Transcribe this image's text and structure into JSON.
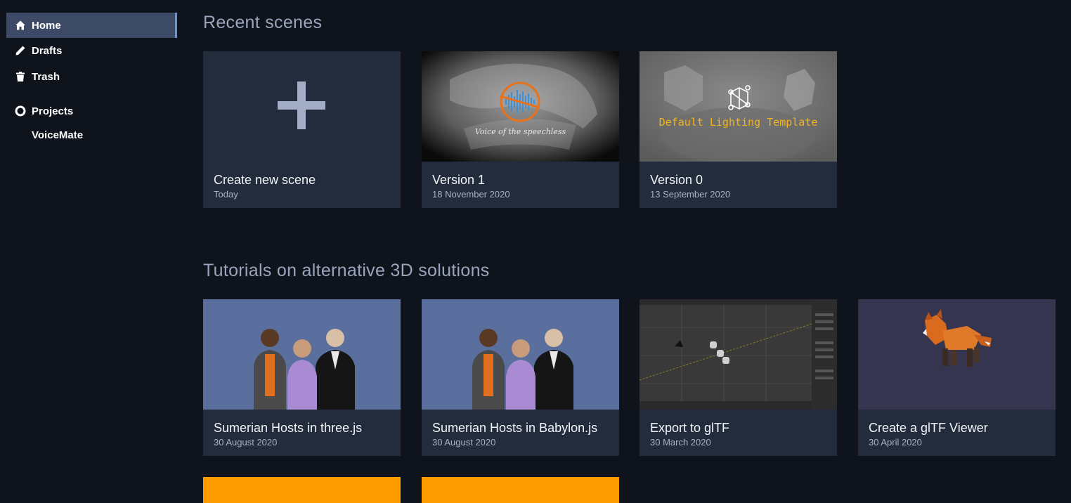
{
  "sidebar": {
    "items": [
      {
        "label": "Home",
        "icon": "home-icon",
        "active": true
      },
      {
        "label": "Drafts",
        "icon": "pencil-icon",
        "active": false
      },
      {
        "label": "Trash",
        "icon": "trash-icon",
        "active": false
      },
      {
        "label": "Projects",
        "icon": "projects-icon",
        "active": false
      }
    ],
    "projects": [
      "VoiceMate"
    ]
  },
  "recent": {
    "title": "Recent scenes",
    "cards": [
      {
        "title": "Create new scene",
        "date": "Today"
      },
      {
        "title": "Version 1",
        "date": "18 November 2020",
        "thumb_caption": "Voice of the speechless"
      },
      {
        "title": "Version 0",
        "date": "13 September 2020",
        "thumb_caption": "Default Lighting Template"
      }
    ]
  },
  "tutorials": {
    "title": "Tutorials on alternative 3D solutions",
    "cards": [
      {
        "title": "Sumerian Hosts in three.js",
        "date": "30 August 2020"
      },
      {
        "title": "Sumerian Hosts in Babylon.js",
        "date": "30 August 2020"
      },
      {
        "title": "Export to glTF",
        "date": "30 March 2020"
      },
      {
        "title": "Create a glTF Viewer",
        "date": "30 April 2020"
      }
    ]
  },
  "colors": {
    "background": "#0f131b",
    "card": "#232c3d",
    "active_nav": "#3d4a66",
    "accent": "#6c93d8",
    "orange": "#ff9c00",
    "hosts_bg": "#5a6f9e",
    "viewer_bg": "#353550"
  }
}
